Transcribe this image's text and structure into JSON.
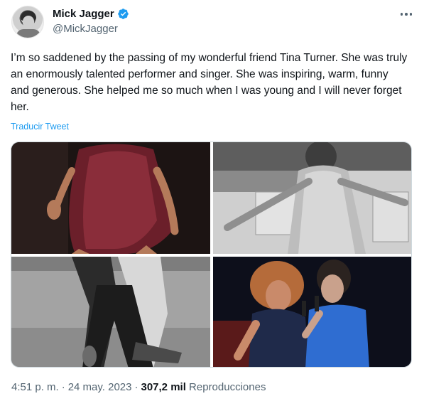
{
  "author": {
    "name": "Mick Jagger",
    "handle": "@MickJagger",
    "verified": true
  },
  "tweet": {
    "text": "I’m so saddened by the passing of my wonderful friend Tina Turner. She was truly an enormously talented performer and singer. She was inspiring, warm, funny and generous. She helped me so much when I was young and I will never forget her.",
    "translate_label": "Traducir Tweet"
  },
  "media": {
    "count": 4,
    "items": [
      {
        "name": "photo-1",
        "tone": "color"
      },
      {
        "name": "photo-2",
        "tone": "grayscale"
      },
      {
        "name": "photo-3",
        "tone": "grayscale"
      },
      {
        "name": "photo-4",
        "tone": "color"
      }
    ]
  },
  "meta": {
    "time": "4:51 p. m.",
    "separator": "·",
    "date": "24 may. 2023",
    "views_count": "307,2 mil",
    "views_label": "Reproducciones"
  },
  "colors": {
    "link": "#1d9bf0",
    "secondary_text": "#536471",
    "primary_text": "#0f1419",
    "border": "#cfd9de"
  },
  "icons": [
    "verified-badge-icon",
    "more-options-icon"
  ]
}
